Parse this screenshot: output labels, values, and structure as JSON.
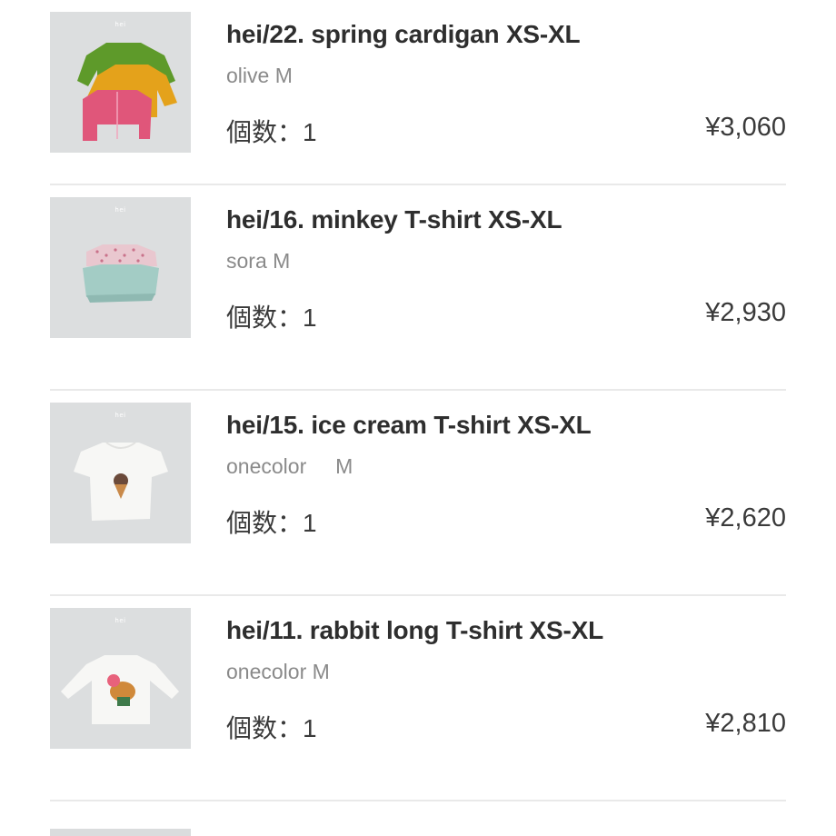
{
  "cart": {
    "items": [
      {
        "title": "hei/22. spring cardigan XS-XL",
        "variant": "olive M",
        "quantity": "個数：1",
        "price": "¥3,060",
        "thumb_brand": "hei"
      },
      {
        "title": "hei/16. minkey T-shirt XS-XL",
        "variant": "sora M",
        "quantity": "個数：1",
        "price": "¥2,930",
        "thumb_brand": "hei"
      },
      {
        "title": "hei/15. ice cream T-shirt XS-XL",
        "variant": "onecolor     M",
        "quantity": "個数：1",
        "price": "¥2,620",
        "thumb_brand": "hei"
      },
      {
        "title": "hei/11. rabbit long T-shirt XS-XL",
        "variant": "onecolor M",
        "quantity": "個数：1",
        "price": "¥2,810",
        "thumb_brand": "hei"
      }
    ]
  },
  "colors": {
    "background": "#ffffff",
    "divider": "#e9e9e9",
    "title": "#2e2e2e",
    "variant": "#8a8a8a",
    "thumb_bg": "#dadcdd"
  }
}
